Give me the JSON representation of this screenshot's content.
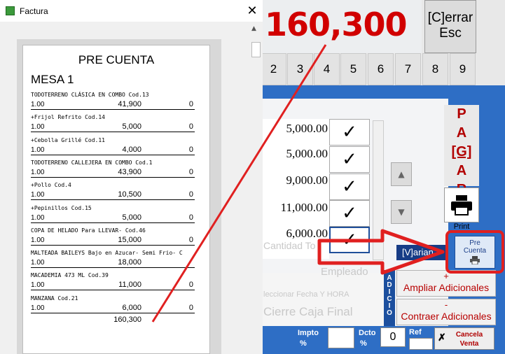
{
  "pos": {
    "total": "160,300",
    "close_button": {
      "line1": "[C]errar",
      "line2": "Esc"
    },
    "numpad": [
      "2",
      "3",
      "4",
      "5",
      "6",
      "7",
      "8",
      "9"
    ],
    "prices": [
      "5,000.00",
      "5,000.00",
      "9,000.00",
      "11,000.00",
      "6,000.00"
    ],
    "check_glyph": "✓",
    "pagar": [
      "P",
      "A",
      "[G]",
      "A",
      "R"
    ],
    "print_label": "Print",
    "precuenta_label": "Pre Cuenta",
    "variante_label": "[V]arian",
    "adicio_label": "ADICIO",
    "ampliar": {
      "sign": "+",
      "label": "Ampliar Adicionales"
    },
    "contraer": {
      "sign": "-",
      "label": "Contraer Adicionales"
    },
    "bottom": {
      "impto": "Impto",
      "impto_pct": "%",
      "dcto": "Dcto",
      "dcto_pct": "%",
      "dcto_value": "0",
      "ref": "Ref",
      "cancel_line1": "Cancela",
      "cancel_line2": "Venta"
    },
    "ghost_text": {
      "empleado": "Empleado",
      "fecha": "leccionar Fecha Y HORA",
      "cierre": "Cierre Caja Final",
      "cantidad": "Cantidad To"
    },
    "accent": "#d10000",
    "frame_blue": "#2e6ec5"
  },
  "factura_window": {
    "title": "Factura",
    "close_glyph": "✕",
    "heading": "PRE CUENTA",
    "mesa": "MESA 1",
    "items": [
      {
        "name": "TODOTERRENO CLÁSICA EN COMBO  Cod.13",
        "qty": "1.00",
        "amount": "41,900",
        "extra": "0"
      },
      {
        "name": "+Frijol Refrito  Cod.14",
        "qty": "1.00",
        "amount": "5,000",
        "extra": "0"
      },
      {
        "name": "+Cebolla Grillé  Cod.11",
        "qty": "1.00",
        "amount": "4,000",
        "extra": "0"
      },
      {
        "name": "TODOTERRENO CALLEJERA EN COMBO  Cod.1",
        "qty": "1.00",
        "amount": "43,900",
        "extra": "0"
      },
      {
        "name": "+Pollo  Cod.4",
        "qty": "1.00",
        "amount": "10,500",
        "extra": "0"
      },
      {
        "name": "+Pepinillos  Cod.15",
        "qty": "1.00",
        "amount": "5,000",
        "extra": "0"
      },
      {
        "name": "COPA DE HELADO Para LLEVAR-  Cod.46",
        "qty": "1.00",
        "amount": "15,000",
        "extra": "0"
      },
      {
        "name": "MALTEADA BAILEYS Bajo en Azucar- Semi Frio-   C",
        "qty": "1.00",
        "amount": "18,000",
        "extra": ""
      },
      {
        "name": "MACADEMIA 473 ML  Cod.39",
        "qty": "1.00",
        "amount": "11,000",
        "extra": "0"
      },
      {
        "name": "MANZANA  Cod.21",
        "qty": "1.00",
        "amount": "6,000",
        "extra": "0"
      }
    ],
    "total": "160,300"
  }
}
